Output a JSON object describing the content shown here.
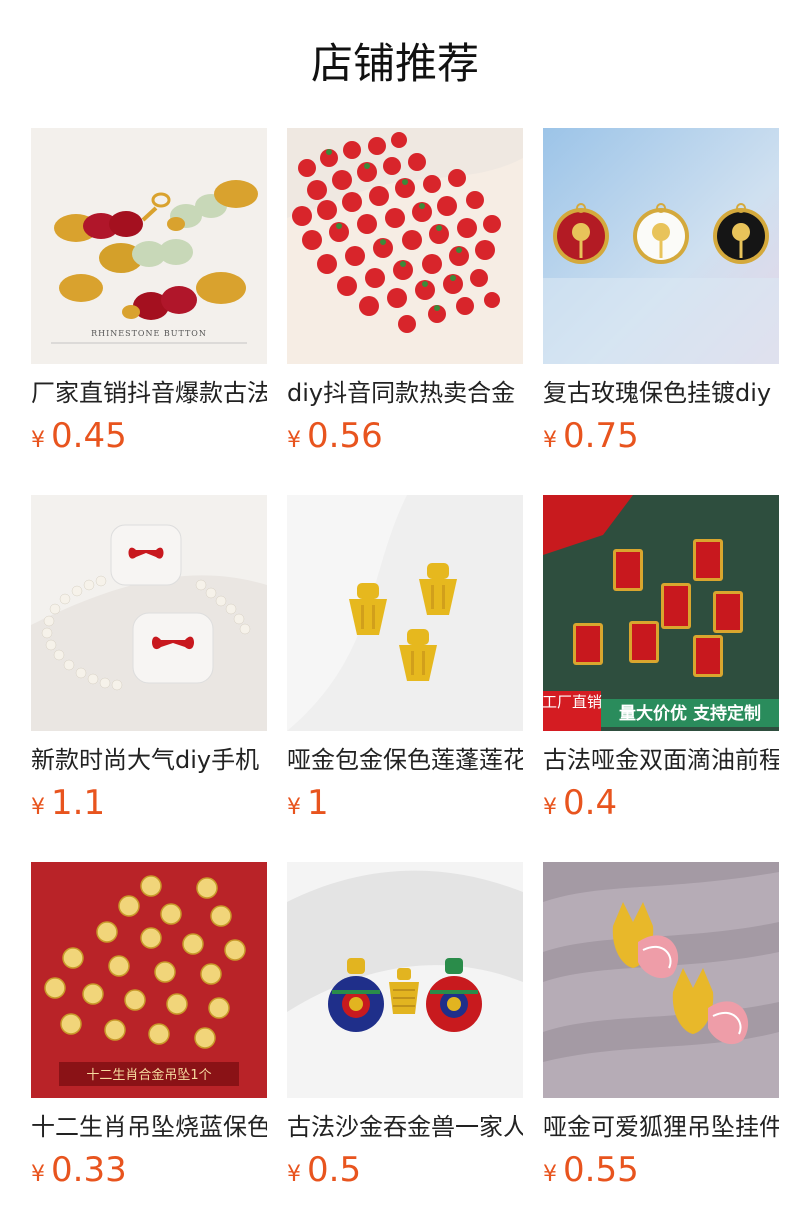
{
  "header": {
    "title": "店铺推荐"
  },
  "colors": {
    "price": "#e8541e"
  },
  "products": [
    {
      "title": "厂家直销抖音爆款古法",
      "currency": "¥",
      "price": "0.45",
      "image_text": "RHINESTONE BUTTON",
      "image": "peanut-pendants"
    },
    {
      "title": "diy抖音同款热卖合金",
      "currency": "¥",
      "price": "0.56",
      "image": "strawberry-charms"
    },
    {
      "title": "复古玫瑰保色挂镀diy",
      "currency": "¥",
      "price": "0.75",
      "image": "rose-enamel-pendants"
    },
    {
      "title": "新款时尚大气diy手机",
      "currency": "¥",
      "price": "1.1",
      "image": "pearl-bow-earphone-case"
    },
    {
      "title": "哑金包金保色莲蓬莲花",
      "currency": "¥",
      "price": "1",
      "image": "lotus-seed-pendants"
    },
    {
      "title": "古法哑金双面滴油前程",
      "currency": "¥",
      "price": "0.4",
      "image_badge": "工厂直销",
      "image_text": "量大价优 支持定制",
      "image": "enamel-tag-charms"
    },
    {
      "title": "十二生肖吊坠烧蓝保色",
      "currency": "¥",
      "price": "0.33",
      "image_text": "十二生肖合金吊坠1个",
      "image": "zodiac-coin-charms"
    },
    {
      "title": "古法沙金吞金兽一家人",
      "currency": "¥",
      "price": "0.5",
      "image": "cloisonne-bell-pendants"
    },
    {
      "title": "哑金可爱狐狸吊坠挂件",
      "currency": "¥",
      "price": "0.55",
      "image": "fox-pendants"
    }
  ]
}
